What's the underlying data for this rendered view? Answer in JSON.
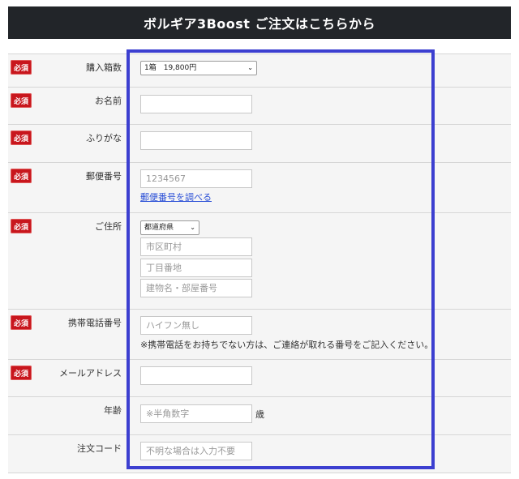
{
  "header": {
    "title": "ボルギア3Boost ご注文はこちらから"
  },
  "required_label": "必須",
  "fields": {
    "quantity": {
      "label": "購入箱数",
      "value": "1箱　19,800円"
    },
    "name": {
      "label": "お名前",
      "value": ""
    },
    "furigana": {
      "label": "ふりがな",
      "value": ""
    },
    "postal": {
      "label": "郵便番号",
      "placeholder": "1234567",
      "link": "郵便番号を調べる"
    },
    "address": {
      "label": "ご住所",
      "prefecture": "都道府県",
      "city_placeholder": "市区町村",
      "street_placeholder": "丁目番地",
      "building_placeholder": "建物名・部屋番号"
    },
    "phone": {
      "label": "携帯電話番号",
      "placeholder": "ハイフン無し",
      "note": "※携帯電話をお持ちでない方は、ご連絡が取れる番号をご記入ください。"
    },
    "email": {
      "label": "メールアドレス",
      "value": ""
    },
    "age": {
      "label": "年齢",
      "placeholder": "※半角数字",
      "unit": "歳"
    },
    "order_code": {
      "label": "注文コード",
      "placeholder": "不明な場合は入力不要"
    }
  },
  "colors": {
    "header_bg": "#222529",
    "badge": "#c8161d",
    "highlight_frame": "#3c3fd0",
    "row_bg": "#f5f5f5",
    "link": "#2a4fd6"
  }
}
